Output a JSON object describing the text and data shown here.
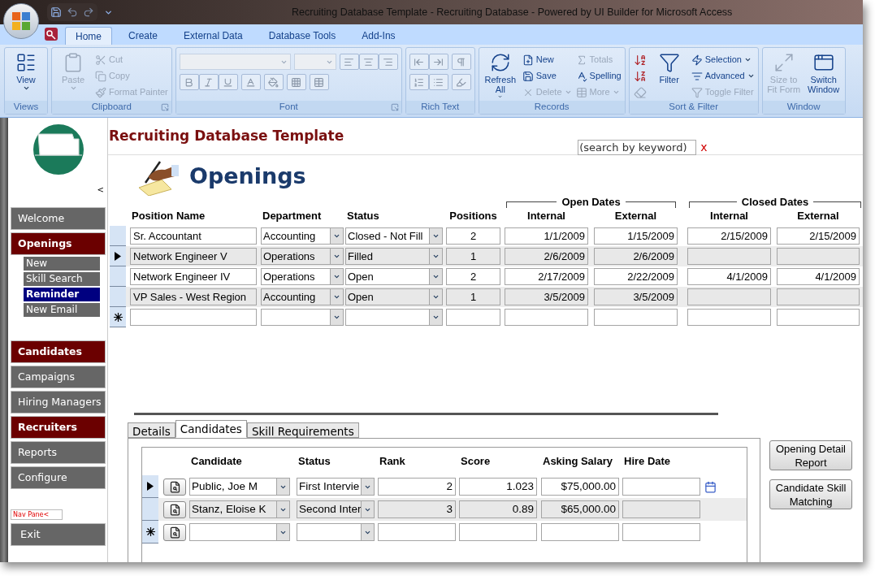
{
  "window": {
    "title": "Recruiting Database Template - Recruiting Database - Powered by UI Builder for Microsoft Access"
  },
  "ribbon_tabs": [
    {
      "label": "Home",
      "selected": true
    },
    {
      "label": "Create",
      "selected": false
    },
    {
      "label": "External Data",
      "selected": false
    },
    {
      "label": "Database Tools",
      "selected": false
    },
    {
      "label": "Add-Ins",
      "selected": false
    }
  ],
  "ribbon_groups": [
    {
      "kind": "buttons",
      "label": "Views",
      "launcher": false,
      "items": [
        {
          "kind": "large",
          "label": "View",
          "disabled": false,
          "menu": true
        }
      ]
    },
    {
      "kind": "buttons",
      "label": "Clipboard",
      "launcher": true,
      "items": [
        {
          "kind": "large",
          "label": "Paste",
          "disabled": true,
          "menu": true
        },
        {
          "kind": "small",
          "label": "Cut",
          "disabled": true,
          "menu": false
        },
        {
          "kind": "small",
          "label": "Copy",
          "disabled": true,
          "menu": false
        },
        {
          "kind": "small",
          "label": "Format Painter",
          "disabled": true,
          "menu": false
        }
      ]
    },
    {
      "kind": "font",
      "label": "Font",
      "launcher": true
    },
    {
      "kind": "rich-text",
      "label": "Rich Text",
      "launcher": false
    },
    {
      "kind": "buttons",
      "label": "Records",
      "launcher": false,
      "items": [
        {
          "kind": "large",
          "label": "Refresh All",
          "disabled": false,
          "menu": true
        },
        {
          "kind": "small",
          "label": "New",
          "disabled": false,
          "menu": false
        },
        {
          "kind": "small",
          "label": "Save",
          "disabled": false,
          "menu": false
        },
        {
          "kind": "small",
          "label": "Delete",
          "disabled": true,
          "menu": true
        },
        {
          "kind": "small",
          "label": "Totals",
          "disabled": true,
          "menu": false
        },
        {
          "kind": "small",
          "label": "Spelling",
          "disabled": false,
          "menu": false
        },
        {
          "kind": "small",
          "label": "More",
          "disabled": true,
          "menu": true
        }
      ]
    },
    {
      "kind": "buttons",
      "label": "Sort & Filter",
      "launcher": false,
      "items": [
        {
          "kind": "icon",
          "disabled": false
        },
        {
          "kind": "icon",
          "disabled": false
        },
        {
          "kind": "icon",
          "disabled": true
        },
        {
          "kind": "large",
          "label": "Filter",
          "disabled": false,
          "menu": false
        },
        {
          "kind": "small",
          "label": "Selection",
          "disabled": false,
          "menu": true
        },
        {
          "kind": "small",
          "label": "Advanced",
          "disabled": false,
          "menu": true
        },
        {
          "kind": "small",
          "label": "Toggle Filter",
          "disabled": true,
          "menu": false
        }
      ]
    },
    {
      "kind": "buttons",
      "label": "Window",
      "launcher": false,
      "items": [
        {
          "kind": "large",
          "label": "Size to Fit Form",
          "disabled": true,
          "menu": false
        },
        {
          "kind": "large",
          "label": "Switch Window",
          "disabled": false,
          "menu": false
        }
      ]
    }
  ],
  "nav": {
    "collapse_button": "<",
    "groups": [
      {
        "items": [
          {
            "kind": "main",
            "label": "Welcome",
            "highlighted": false
          },
          {
            "kind": "main",
            "label": "Openings",
            "highlighted": true
          },
          {
            "kind": "sub",
            "label": "New",
            "highlighted": false
          },
          {
            "kind": "sub",
            "label": "Skill Search",
            "highlighted": false
          },
          {
            "kind": "sub",
            "label": "Reminder",
            "highlighted": true
          },
          {
            "kind": "sub",
            "label": "New Email",
            "highlighted": false
          }
        ]
      },
      {
        "items": [
          {
            "kind": "main",
            "label": "Candidates",
            "highlighted": true
          },
          {
            "kind": "main",
            "label": "Campaigns",
            "highlighted": false
          },
          {
            "kind": "main",
            "label": "Hiring Managers",
            "highlighted": false
          },
          {
            "kind": "main",
            "label": "Recruiters",
            "highlighted": true
          },
          {
            "kind": "main",
            "label": "Reports",
            "highlighted": false
          },
          {
            "kind": "main",
            "label": "Configure",
            "highlighted": false
          }
        ]
      }
    ],
    "pane_label": "Nav Pane<",
    "exit_button": "Exit"
  },
  "form": {
    "title": "Recruiting Database Template",
    "search": {
      "placeholder": "(search by keyword)"
    },
    "clear_button": "x",
    "heading": "Openings",
    "openings": {
      "column_groups": [
        {
          "label": "Open Dates"
        },
        {
          "label": "Closed Dates"
        }
      ],
      "columns": [
        {
          "label": "Position Name",
          "kind": "text"
        },
        {
          "label": "Department",
          "kind": "combo"
        },
        {
          "label": "Status",
          "kind": "combo"
        },
        {
          "label": "Positions",
          "kind": "number"
        },
        {
          "label": "Internal",
          "kind": "date"
        },
        {
          "label": "External",
          "kind": "date"
        },
        {
          "label": "Internal",
          "kind": "date"
        },
        {
          "label": "External",
          "kind": "date"
        }
      ],
      "rows": [
        {
          "kind": "record",
          "current": false,
          "cells": [
            "Sr. Accountant",
            "Accounting",
            "Closed - Not Fill",
            "2",
            "1/1/2009",
            "1/15/2009",
            "2/15/2009",
            "2/15/2009"
          ]
        },
        {
          "kind": "record",
          "current": true,
          "cells": [
            "Network Engineer V",
            "Operations",
            "Filled",
            "1",
            "2/6/2009",
            "2/6/2009",
            null,
            null
          ]
        },
        {
          "kind": "record",
          "current": false,
          "cells": [
            "Network Engineer IV",
            "Operations",
            "Open",
            "2",
            "2/17/2009",
            "2/22/2009",
            "4/1/2009",
            "4/1/2009"
          ]
        },
        {
          "kind": "record",
          "current": false,
          "cells": [
            "VP Sales - West Region",
            "Accounting",
            "Open",
            "1",
            "3/5/2009",
            "3/5/2009",
            null,
            null
          ]
        },
        {
          "kind": "new",
          "current": false,
          "cells": []
        }
      ]
    },
    "subform": {
      "tabs": [
        {
          "label": "Details",
          "selected": false
        },
        {
          "label": "Candidates",
          "selected": true
        },
        {
          "label": "Skill Requirements",
          "selected": false
        }
      ],
      "columns": [
        {
          "label": "Candidate",
          "kind": "combo"
        },
        {
          "label": "Status",
          "kind": "combo"
        },
        {
          "label": "Rank",
          "kind": "number"
        },
        {
          "label": "Score",
          "kind": "number"
        },
        {
          "label": "Asking Salary",
          "kind": "number"
        },
        {
          "label": "Hire Date",
          "kind": "date"
        }
      ],
      "rows": [
        {
          "kind": "record",
          "current": true,
          "cells": [
            "Public, Joe M",
            "First Intervie",
            "2",
            "1.023",
            "$75,000.00",
            null
          ]
        },
        {
          "kind": "record",
          "current": false,
          "cells": [
            "Stanz, Eloise K",
            "Second Inter",
            "3",
            "0.89",
            "$65,000.00",
            null
          ]
        },
        {
          "kind": "new",
          "current": false,
          "cells": []
        }
      ]
    },
    "actions": [
      {
        "label": "Opening Detail Report"
      },
      {
        "label": "Candidate Skill Matching"
      }
    ]
  }
}
